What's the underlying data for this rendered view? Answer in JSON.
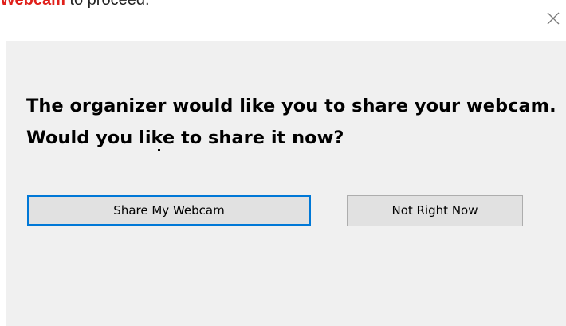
{
  "background_text": {
    "link": "Webcam",
    "rest": " to proceed."
  },
  "dialog": {
    "close_icon": "close-x-icon",
    "message": "The organizer would like you to share your webcam. Would you like to share it now?",
    "primary_button": "Share My Webcam",
    "secondary_button": "Not Right Now"
  },
  "colors": {
    "dialog_background": "#f0f0f0",
    "button_background": "#e1e1e1",
    "focus_border": "#0078d7",
    "link_text": "#e0201b"
  }
}
